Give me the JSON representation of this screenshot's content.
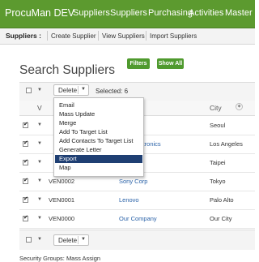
{
  "app": {
    "brand": "ProcuMan DEV",
    "nav": [
      "Suppliers",
      "Suppliers",
      "Purchasing",
      "Activities",
      "Master Da"
    ]
  },
  "subnav": {
    "title": "Suppliers :",
    "links": [
      "Create Supplier",
      "View Suppliers",
      "Import Suppliers"
    ]
  },
  "page": {
    "title": "Search Suppliers",
    "filters_label": "Filters",
    "show_all_label": "Show All"
  },
  "toolbar": {
    "delete_label": "Delete",
    "selected_text": "Selected:  6"
  },
  "table": {
    "headers": {
      "vendor": "V",
      "city": "City"
    },
    "rows": [
      {
        "code": "",
        "name": "",
        "city": "Seoul"
      },
      {
        "code": "",
        "name": "mer Electronics",
        "city": "Los Angeles"
      },
      {
        "code": "",
        "name": "",
        "city": "Taipei"
      },
      {
        "code": "VEN0002",
        "name": "Sony Corp",
        "city": "Tokyo"
      },
      {
        "code": "VEN0001",
        "name": "Lenovo",
        "city": "Palo Alto"
      },
      {
        "code": "VEN0000",
        "name": "Our Company",
        "city": "Our City"
      }
    ]
  },
  "menu": {
    "items": [
      "Email",
      "Mass Update",
      "Merge",
      "Add To Target List",
      "Add Contacts To Target List",
      "Generate Letter",
      "Export",
      "Map"
    ],
    "active_index": 6
  },
  "bottom": {
    "delete_label": "Delete",
    "footer_text": "Security Groups: Mass Assign"
  },
  "colors": {
    "nav_green": "#5c9a2f",
    "button_green": "#4f9a2e",
    "link_blue": "#2a62a8",
    "menu_highlight": "#1f3f73"
  }
}
